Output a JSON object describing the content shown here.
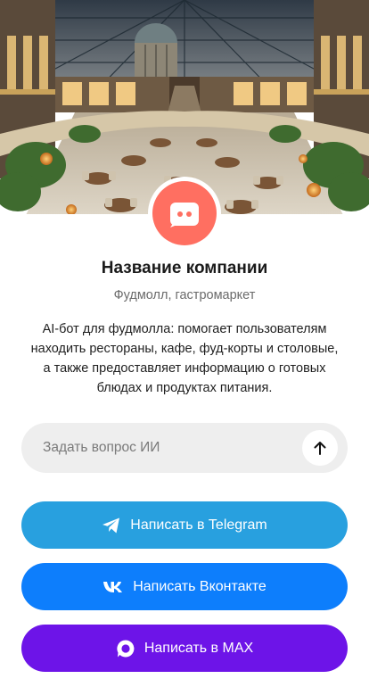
{
  "hero": {
    "image_name": "food-mall-atrium-image"
  },
  "company": {
    "avatar_icon": "chat-bot-icon",
    "avatar_color": "#ff6f61",
    "name": "Название компании",
    "category": "Фудмолл, гастромаркет",
    "description": "AI-бот для фудмолла: помогает пользователям находить рестораны, кафе, фуд-корты и столовые, а также предоставляет информацию о готовых блюдах и продуктах питания."
  },
  "ask": {
    "placeholder": "Задать вопрос ИИ",
    "value": "",
    "send_icon": "arrow-up-icon"
  },
  "buttons": {
    "telegram": {
      "label": "Написать в Telegram",
      "icon": "telegram-icon",
      "color": "#28a0df"
    },
    "vk": {
      "label": "Написать Вконтакте",
      "icon": "vk-icon",
      "color": "#0d7efc"
    },
    "max": {
      "label": "Написать в MAX",
      "icon": "max-icon",
      "color": "#6d14e8"
    }
  }
}
